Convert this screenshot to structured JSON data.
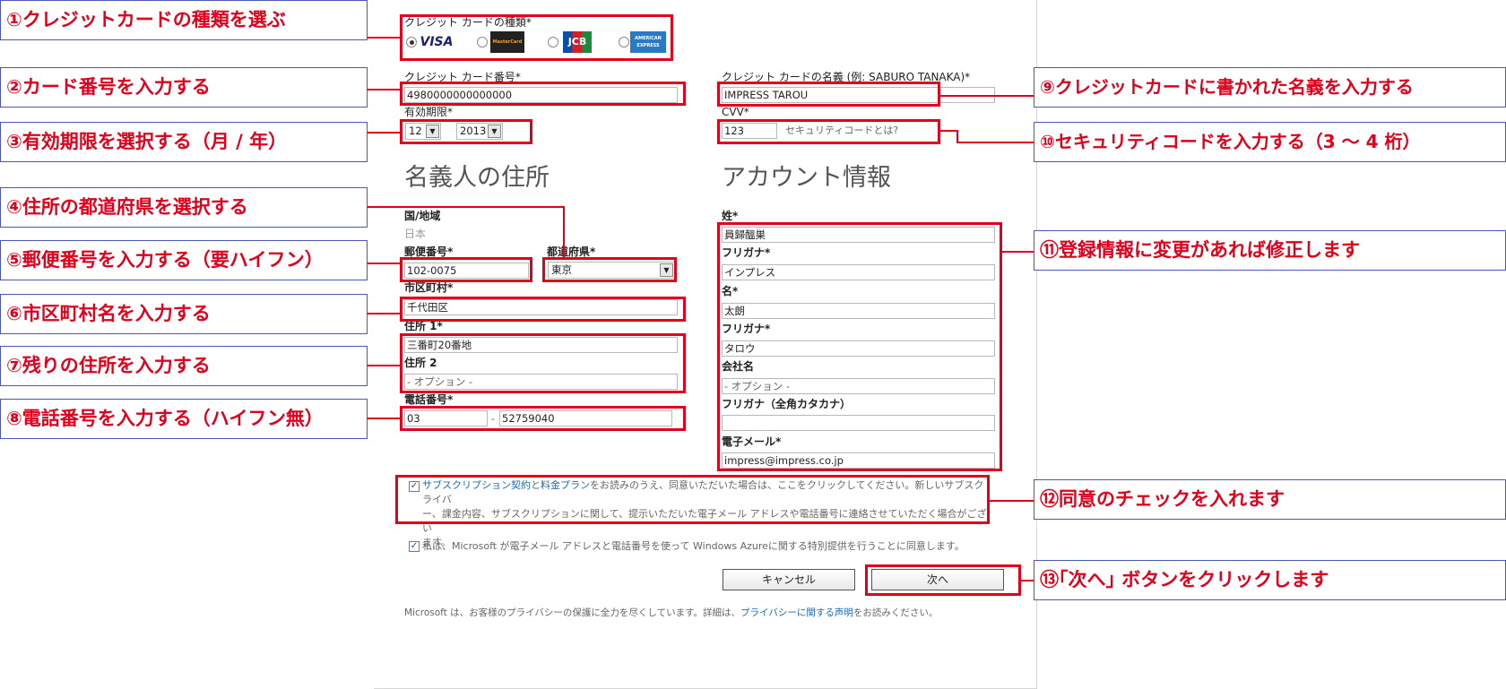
{
  "callouts": {
    "c1": "①クレジットカードの種類を選ぶ",
    "c2": "②カード番号を入力する",
    "c3": "③有効期限を選択する（月 / 年）",
    "c4": "④住所の都道府県を選択する",
    "c5": "⑤郵便番号を入力する（要ハイフン）",
    "c6": "⑥市区町村名を入力する",
    "c7": "⑦残りの住所を入力する",
    "c8": "⑧電話番号を入力する（ハイフン無）",
    "c9": "⑨クレジットカードに書かれた名義を入力する",
    "c10": "⑩セキュリティコードを入力する（3 ～ 4 桁）",
    "c11": "⑪登録情報に変更があれば修正します",
    "c12": "⑫同意のチェックを入れます",
    "c13": "⑬｢次へ｣ ボタンをクリックします"
  },
  "card_type": {
    "label": "クレジット カードの種類*",
    "options": [
      {
        "name": "VISA",
        "selected": true
      },
      {
        "name": "MasterCard",
        "selected": false
      },
      {
        "name": "JCB",
        "selected": false
      },
      {
        "name": "AMERICAN EXPRESS",
        "selected": false
      }
    ],
    "logos": {
      "visa": "VISA",
      "mastercard": "MasterCard",
      "jcb": "JCB",
      "amex": "AMERICAN EXPRESS"
    }
  },
  "card_number": {
    "label": "クレジット カード番号*",
    "value": "4980000000000000"
  },
  "expiry": {
    "label": "有効期限*",
    "month": "12",
    "year": "2013"
  },
  "card_name": {
    "label": "クレジット カードの名義 (例: SABURO TANAKA)*",
    "value": "IMPRESS TAROU"
  },
  "cvv": {
    "label": "CVV*",
    "value": "123",
    "help_link": "セキュリティコードとは?"
  },
  "address": {
    "heading": "名義人の住所",
    "country_label": "国/地域",
    "country_value": "日本",
    "postal_label": "郵便番号*",
    "postal_value": "102-0075",
    "pref_label": "都道府県*",
    "pref_value": "東京",
    "city_label": "市区町村*",
    "city_value": "千代田区",
    "addr1_label": "住所 1*",
    "addr1_value": "三番町20番地",
    "addr2_label": "住所 2",
    "addr2_placeholder": "- オプション -",
    "phone_label": "電話番号*",
    "phone_area": "03",
    "phone_sep": "-",
    "phone_number": "52759040"
  },
  "account": {
    "heading": "アカウント情報",
    "last_label": "姓*",
    "last_value": "員歸醞巣",
    "last_kana_label": "フリガナ*",
    "last_kana_value": "インプレス",
    "first_label": "名*",
    "first_value": "太朗",
    "first_kana_label": "フリガナ*",
    "first_kana_value": "タロウ",
    "company_label": "会社名",
    "company_placeholder": "- オプション -",
    "company_kana_label": "フリガナ（全角カタカナ）",
    "company_kana_value": "",
    "email_label": "電子メール*",
    "email_value": "impress@impress.co.jp"
  },
  "agreement": {
    "link1": "サブスクリプション契約",
    "mid": "と",
    "link2": "料金プラン",
    "text": "をお読みのうえ、同意いただいた場合は、ここをクリックしてください。新しいサブスクライバ",
    "text2": "ー、課金内容、サブスクリプションに関して、提示いただいた電子メール アドレスや電話番号に連絡させていただく場合がござい",
    "text3": "ます。",
    "checked": true
  },
  "offers": {
    "text": "私は、Microsoft が電子メール アドレスと電話番号を使って Windows Azureに関する特別提供を行うことに同意します。",
    "checked": true
  },
  "buttons": {
    "cancel": "キャンセル",
    "next": "次へ"
  },
  "privacy": {
    "prefix": "Microsoft は、お客様のプライバシーの保護に全力を尽くしています。詳細は、",
    "link": "プライバシーに関する声明",
    "suffix": "をお読みください。"
  },
  "colors": {
    "accent": "#e0001b",
    "link": "#1a6cb5",
    "callout_border": "#4a56b8"
  }
}
